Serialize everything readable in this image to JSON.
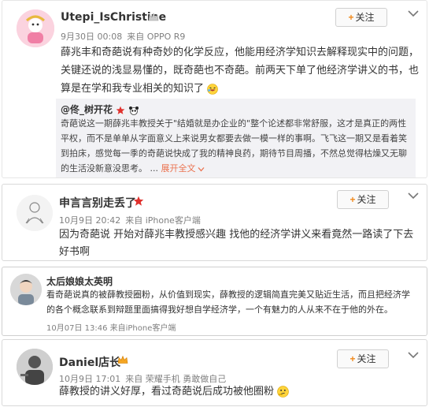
{
  "posts": [
    {
      "username": "Utepi_IsChristine",
      "date": "9月30日 00:08",
      "source": "来自 OPPO R9",
      "follow_label": "关注",
      "text": "薛兆丰和奇葩说有种奇妙的化学反应，他能用经济学知识去解释现实中的问题，关键还说的浅显易懂的，既奇葩也不奇葩。前两天下单了他经济学讲义的书，也算是在学和我专业相关的知识了",
      "repost": {
        "username": "@佟_树开花",
        "text": "奇葩说这一期薛兆丰教授关于\"结婚就是办企业的\"整个论述都非常舒服，这才是真正的两性平权，而不是单单从字面意义上来说男女都要去做一模一样的事啊。飞飞这一期又是看着笑到拍床，感觉每一季的奇葩说快成了我的精神良药，期待节目周播，不然总觉得枯燥又无聊的生活没新意没思考。 ...",
        "expand_label": "展开全文"
      }
    },
    {
      "username": "申言言别走丢了",
      "date": "10月9日 20:42",
      "source": "来自 iPhone客户端",
      "follow_label": "关注",
      "text": "因为奇葩说 开始对薛兆丰教授感兴趣 找他的经济学讲义来看竟然一路读了下去好书啊"
    },
    {
      "username": "太后娘娘太英明",
      "timestamp": "10月07日 13:46 来自iPhone客户端",
      "text": "看奇葩说真的被薛教授圈粉，从价值到现实，薛教授的逻辑简直完美又贴近生活，而且把经济学的各个概念联系到辩题里面搞得我好想自学经济学，一个有魅力的人从来不在于他的外在。"
    },
    {
      "username": "Daniel店长",
      "date": "10月9日 17:01",
      "source": "来自 荣耀手机 勇敢做自己",
      "follow_label": "关注",
      "text": "薛教授的讲义好厚，看过奇葩说后成功被他圈粉"
    }
  ],
  "colors": {
    "accent": "#f08a1d",
    "link": "#eb7350",
    "meta": "#808080",
    "repost_bg": "#f2f2f5",
    "badge_red": "#e0312d"
  },
  "icons": [
    "avatar",
    "vip-crown-icon",
    "red-star-icon",
    "panda-emoji-icon",
    "laugh-emoji-icon",
    "thinking-emoji-icon",
    "chevron-down-icon",
    "plus-icon",
    "expand-arrow-icon"
  ]
}
